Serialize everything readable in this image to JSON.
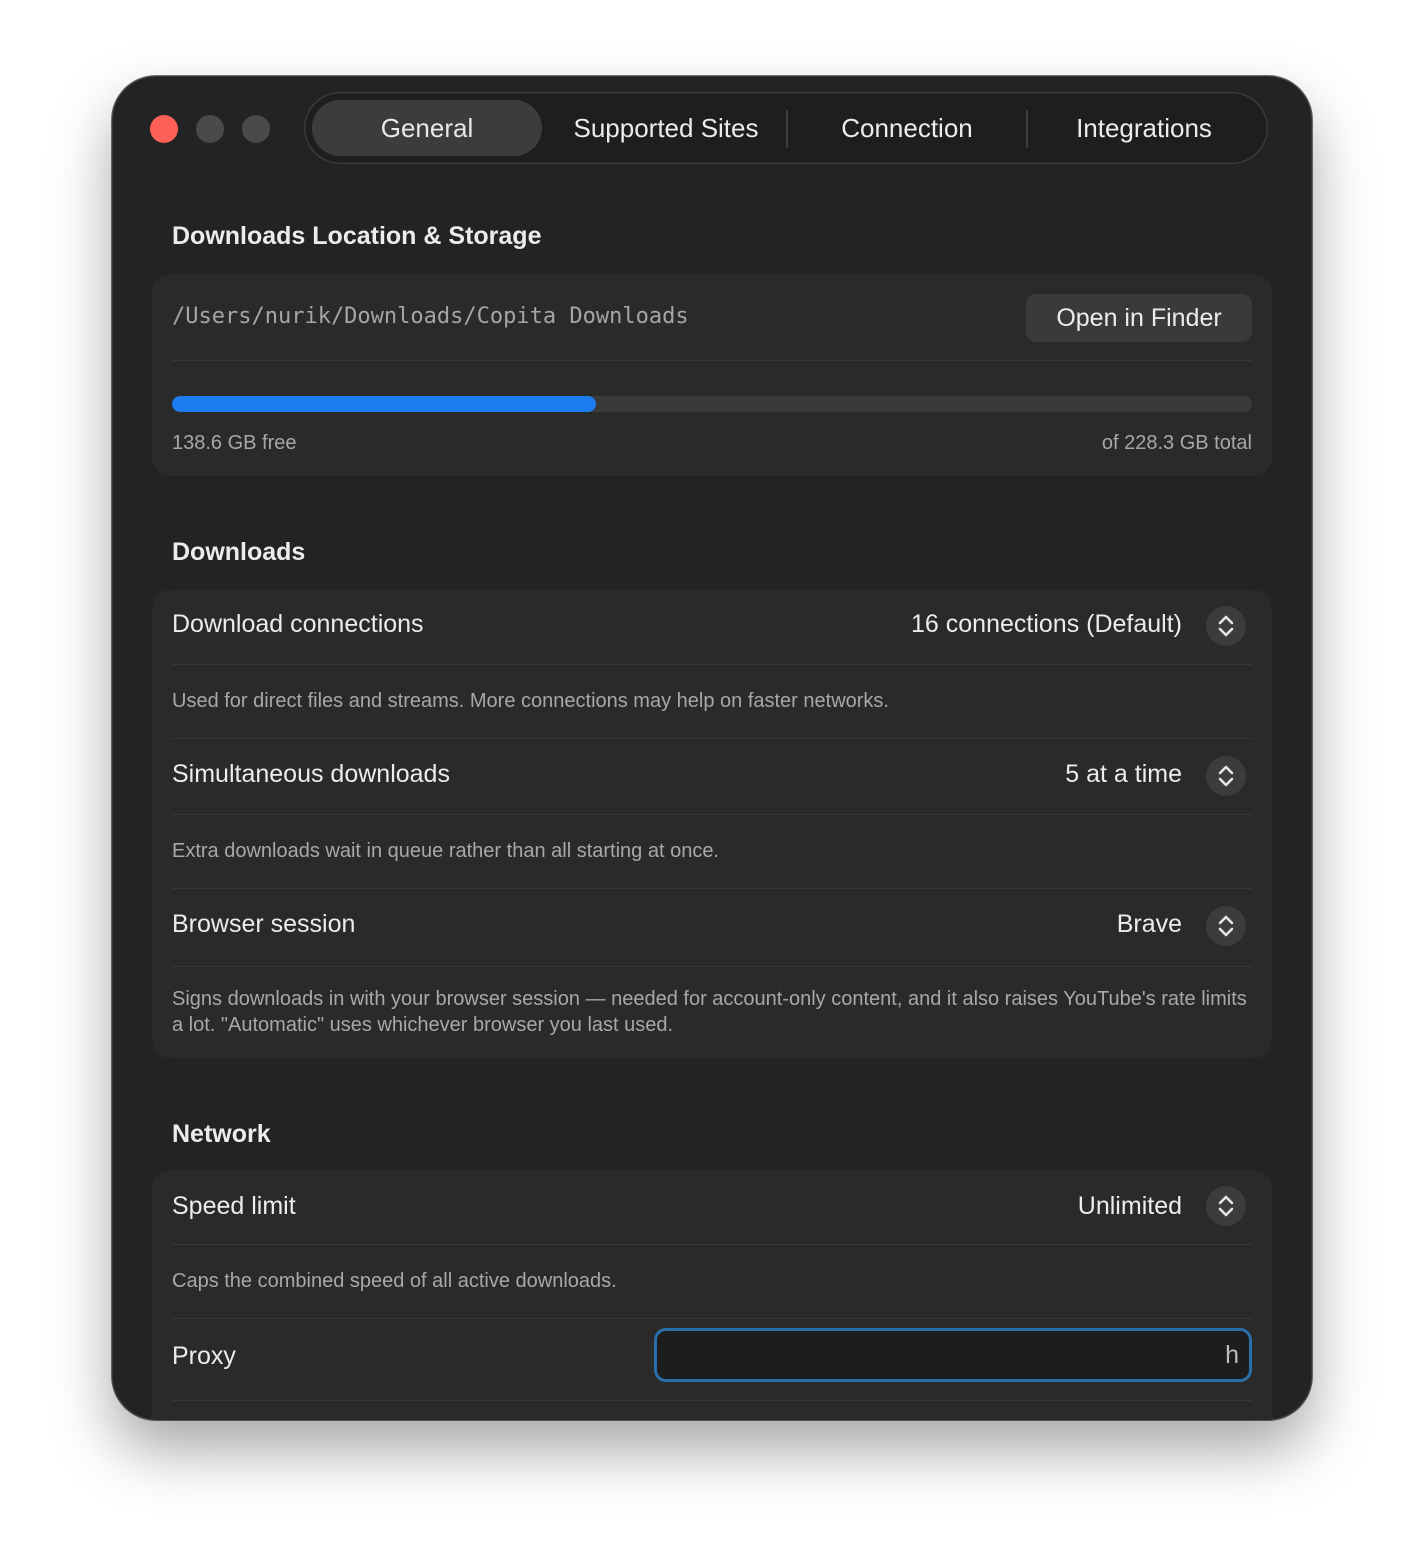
{
  "tabs": [
    {
      "label": "General",
      "active": true
    },
    {
      "label": "Supported Sites",
      "active": false
    },
    {
      "label": "Connection",
      "active": false
    },
    {
      "label": "Integrations",
      "active": false
    }
  ],
  "storage": {
    "title": "Downloads Location & Storage",
    "path": "/Users/nurik/Downloads/Copita Downloads",
    "open_button": "Open in Finder",
    "free": "138.6 GB free",
    "total": "of 228.3 GB total",
    "used_fraction": 0.393
  },
  "downloads": {
    "title": "Downloads",
    "connections_label": "Download connections",
    "connections_value": "16 connections (Default)",
    "connections_desc": "Used for direct files and streams. More connections may help on faster networks.",
    "simultaneous_label": "Simultaneous downloads",
    "simultaneous_value": "5 at a time",
    "simultaneous_desc": "Extra downloads wait in queue rather than all starting at once.",
    "browser_label": "Browser session",
    "browser_value": "Brave",
    "browser_desc": "Signs downloads in with your browser session — needed for account-only content, and it also raises YouTube's rate limits a lot. \"Automatic\" uses whichever browser you last used."
  },
  "network": {
    "title": "Network",
    "speed_label": "Speed limit",
    "speed_value": "Unlimited",
    "speed_desc": "Caps the combined speed of all active downloads.",
    "proxy_label": "Proxy",
    "proxy_value": "h"
  },
  "colors": {
    "accent": "#1b7cf0",
    "close": "#fe5f57",
    "focus_ring": "#2a6fa8"
  }
}
